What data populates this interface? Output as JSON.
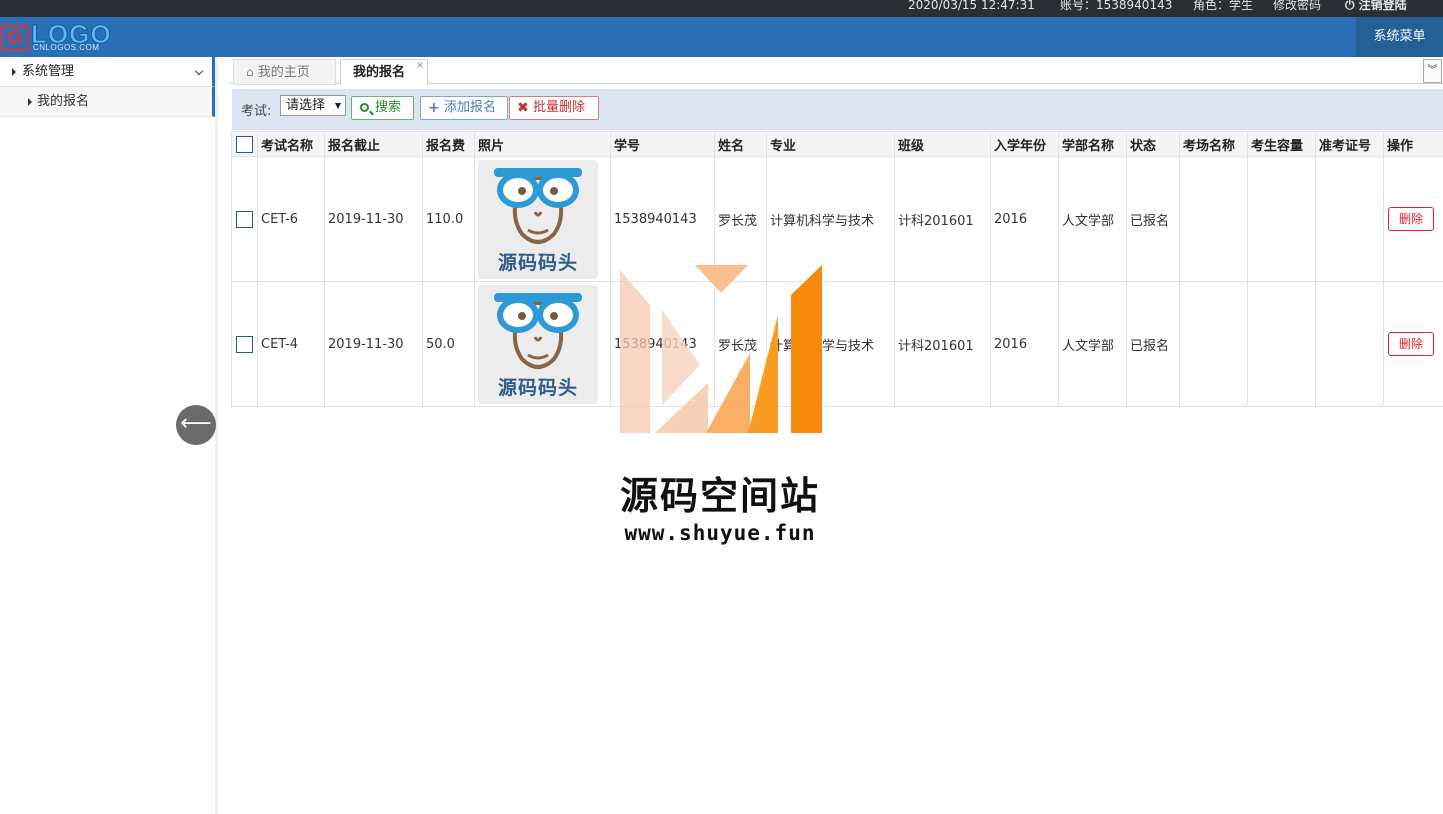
{
  "topbar": {
    "datetime": "2020/03/15 12:47:31",
    "account": "账号：1538940143",
    "role": "角色：学生",
    "change_password": "修改密码",
    "logout": "注销登陆"
  },
  "header": {
    "logo_main": "LOGO",
    "logo_sub": "CNLOGOS.COM",
    "logo_box": "G",
    "system_menu": "系统菜单"
  },
  "sidebar": {
    "items": [
      {
        "label": "系统管理"
      },
      {
        "label": "我的报名"
      }
    ]
  },
  "tabs": {
    "home": "我的主页",
    "active": "我的报名",
    "close": "×"
  },
  "toolbar": {
    "exam_label": "考试:",
    "exam_select": "请选择",
    "search": "搜索",
    "add": "添加报名",
    "batch_delete": "批量删除"
  },
  "table": {
    "columns": [
      "考试名称",
      "报名截止",
      "报名费",
      "照片",
      "学号",
      "姓名",
      "专业",
      "班级",
      "入学年份",
      "学部名称",
      "状态",
      "考场名称",
      "考生容量",
      "准考证号",
      "操作"
    ],
    "rows": [
      {
        "exam": "CET-6",
        "deadline": "2019-11-30",
        "fee": "110.0",
        "photo_caption": "源码码头",
        "student_id": "1538940143",
        "name": "罗长茂",
        "major": "计算机科学与技术",
        "class": "计科201601",
        "year": "2016",
        "dept": "人文学部",
        "status": "已报名",
        "room": "",
        "capacity": "",
        "ticket": "",
        "action": "删除"
      },
      {
        "exam": "CET-4",
        "deadline": "2019-11-30",
        "fee": "50.0",
        "photo_caption": "源码码头",
        "student_id": "1538940143",
        "name": "罗长茂",
        "major": "计算机科学与技术",
        "class": "计科201601",
        "year": "2016",
        "dept": "人文学部",
        "status": "已报名",
        "room": "",
        "capacity": "",
        "ticket": "",
        "action": "删除"
      }
    ]
  },
  "watermark": {
    "title": "源码空间站",
    "url": "www.shuyue.fun"
  },
  "colors": {
    "header_bg": "#2a6fb5",
    "topbar_bg": "#2b2f33",
    "delete_red": "#dd2233",
    "watermark_orange": "#f7890c"
  }
}
